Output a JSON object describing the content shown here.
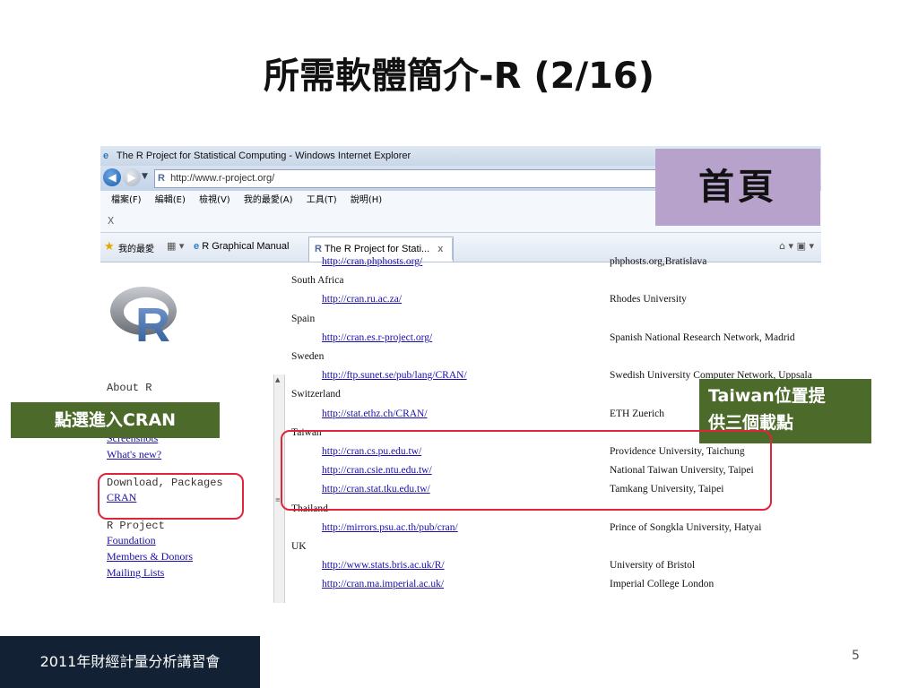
{
  "slide": {
    "title": "所需軟體簡介-R (2/16)",
    "footer": "2011年財經計量分析講習會",
    "page_number": "5"
  },
  "browser": {
    "window_title": "The R Project for Statistical Computing - Windows Internet Explorer",
    "url": "http://www.r-project.org/",
    "menu": [
      "檔案(F)",
      "編輯(E)",
      "檢視(V)",
      "我的最愛(A)",
      "工具(T)",
      "說明(H)"
    ],
    "x_bar": "X",
    "favorites_label": "我的最愛",
    "fav_link": "R Graphical Manual",
    "active_tab": "The R Project for Stati...",
    "tab_close": "x"
  },
  "side_nav": {
    "about_heading": "About R",
    "about_links": [
      "Screenshots",
      "What's new?"
    ],
    "download_heading": "Download, Packages",
    "cran_link": "CRAN",
    "project_heading": "R Project",
    "project_links": [
      "Foundation",
      "Members & Donors",
      "Mailing Lists"
    ]
  },
  "mirrors": [
    {
      "type": "mirror",
      "url": "http://cran.phphosts.org/",
      "host": "phphosts.org,Bratislava"
    },
    {
      "type": "country",
      "name": "South Africa"
    },
    {
      "type": "mirror",
      "url": "http://cran.ru.ac.za/",
      "host": "Rhodes University"
    },
    {
      "type": "country",
      "name": "Spain"
    },
    {
      "type": "mirror",
      "url": "http://cran.es.r-project.org/",
      "host": "Spanish National Research Network, Madrid"
    },
    {
      "type": "country",
      "name": "Sweden"
    },
    {
      "type": "mirror",
      "url": "http://ftp.sunet.se/pub/lang/CRAN/",
      "host": "Swedish University Computer Network, Uppsala"
    },
    {
      "type": "country",
      "name": "Switzerland"
    },
    {
      "type": "mirror",
      "url": "http://stat.ethz.ch/CRAN/",
      "host": "ETH Zuerich"
    },
    {
      "type": "country",
      "name": "Taiwan"
    },
    {
      "type": "mirror",
      "url": "http://cran.cs.pu.edu.tw/",
      "host": "Providence University, Taichung"
    },
    {
      "type": "mirror",
      "url": "http://cran.csie.ntu.edu.tw/",
      "host": "National Taiwan University, Taipei"
    },
    {
      "type": "mirror",
      "url": "http://cran.stat.tku.edu.tw/",
      "host": "Tamkang University, Taipei"
    },
    {
      "type": "country",
      "name": "Thailand"
    },
    {
      "type": "mirror",
      "url": "http://mirrors.psu.ac.th/pub/cran/",
      "host": "Prince of Songkla University, Hatyai"
    },
    {
      "type": "country",
      "name": "UK"
    },
    {
      "type": "mirror",
      "url": "http://www.stats.bris.ac.uk/R/",
      "host": "University of Bristol"
    },
    {
      "type": "mirror",
      "url": "http://cran.ma.imperial.ac.uk/",
      "host": "Imperial College London"
    }
  ],
  "callouts": {
    "home": "首頁",
    "click_cran": "點選進入CRAN",
    "taiwan_line1": "Taiwan位置提",
    "taiwan_line2": "供三個載點"
  },
  "colors": {
    "callout_green": "#4c6b2a",
    "callout_purple": "#b7a2cc",
    "highlight_red": "#e0243a",
    "footer_navy": "#122134"
  }
}
